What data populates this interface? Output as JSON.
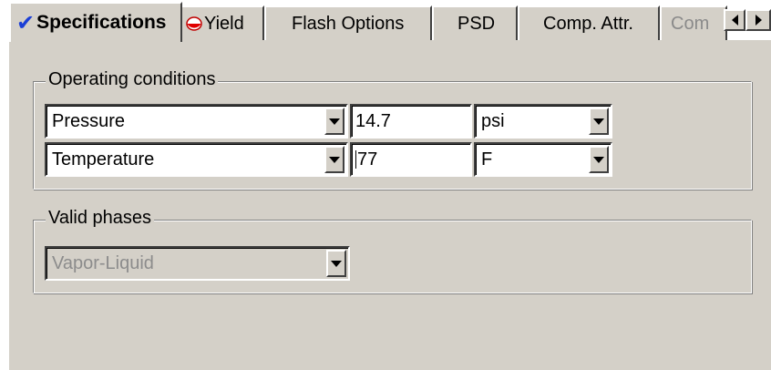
{
  "tabs": [
    {
      "label": "Specifications",
      "icon": "check-icon",
      "active": true
    },
    {
      "label": "Yield",
      "icon": "yield-icon",
      "active": false
    },
    {
      "label": "Flash Options",
      "active": false
    },
    {
      "label": "PSD",
      "active": false
    },
    {
      "label": "Comp. Attr.",
      "active": false
    },
    {
      "label": "Com",
      "active": false
    }
  ],
  "operating_conditions": {
    "title": "Operating conditions",
    "rows": [
      {
        "variable": "Pressure",
        "value": "14.7",
        "unit": "psi"
      },
      {
        "variable": "Temperature",
        "value": "77",
        "unit": "F"
      }
    ]
  },
  "valid_phases": {
    "title": "Valid phases",
    "value": "Vapor-Liquid"
  },
  "colors": {
    "panel": "#d4d0c8",
    "check": "#1b3fd6",
    "disabled_text": "#8c8c8c"
  }
}
